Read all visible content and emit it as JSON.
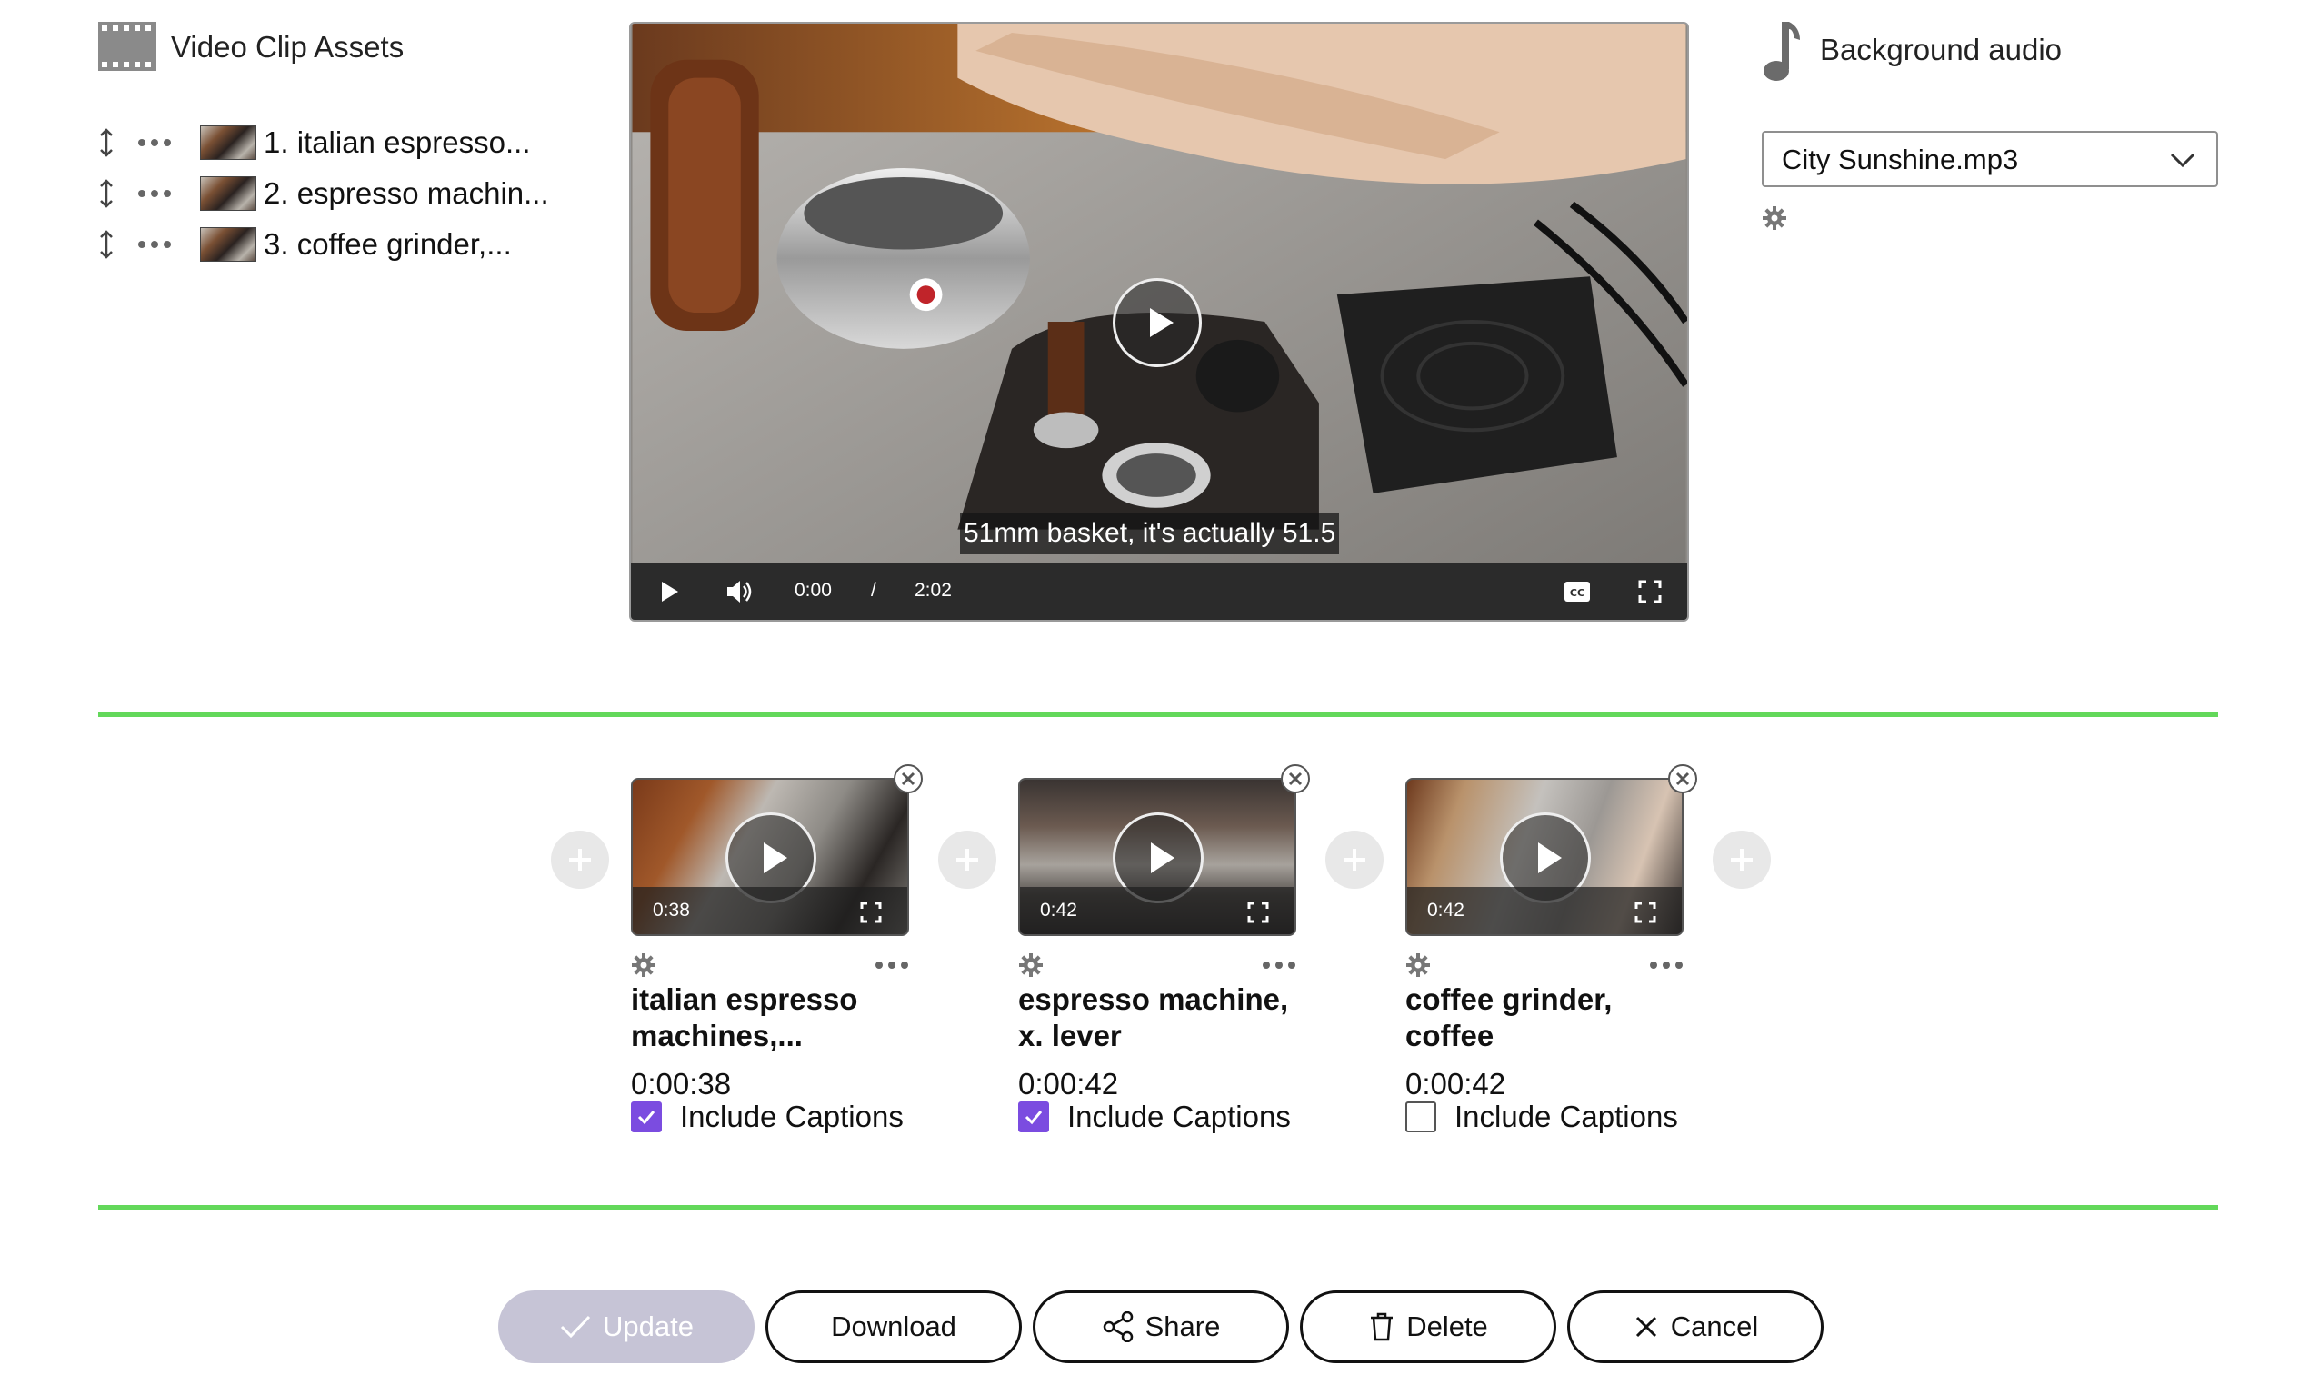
{
  "assets": {
    "title": "Video Clip Assets",
    "items": [
      {
        "label": "1. italian espresso..."
      },
      {
        "label": "2. espresso machin..."
      },
      {
        "label": "3. coffee grinder,..."
      }
    ]
  },
  "player": {
    "caption": "51mm basket, it's actually 51.5",
    "current_time": "0:00",
    "separator": "/",
    "total_time": "2:02"
  },
  "audio": {
    "title": "Background audio",
    "selected": "City Sunshine.mp3"
  },
  "timeline": {
    "clips": [
      {
        "thumb_duration": "0:38",
        "title": "italian espresso machines,...",
        "time": "0:00:38",
        "captions_label": "Include Captions",
        "captions_checked": true
      },
      {
        "thumb_duration": "0:42",
        "title": "espresso machine, x. lever",
        "time": "0:00:42",
        "captions_label": "Include Captions",
        "captions_checked": true
      },
      {
        "thumb_duration": "0:42",
        "title": "coffee grinder, coffee",
        "time": "0:00:42",
        "captions_label": "Include Captions",
        "captions_checked": false
      }
    ]
  },
  "actions": {
    "update": "Update",
    "download": "Download",
    "share": "Share",
    "delete": "Delete",
    "cancel": "Cancel"
  },
  "colors": {
    "accent_green": "#63d85a",
    "checkbox_purple": "#7b4ce0",
    "disabled_button": "#c6c4d6"
  }
}
